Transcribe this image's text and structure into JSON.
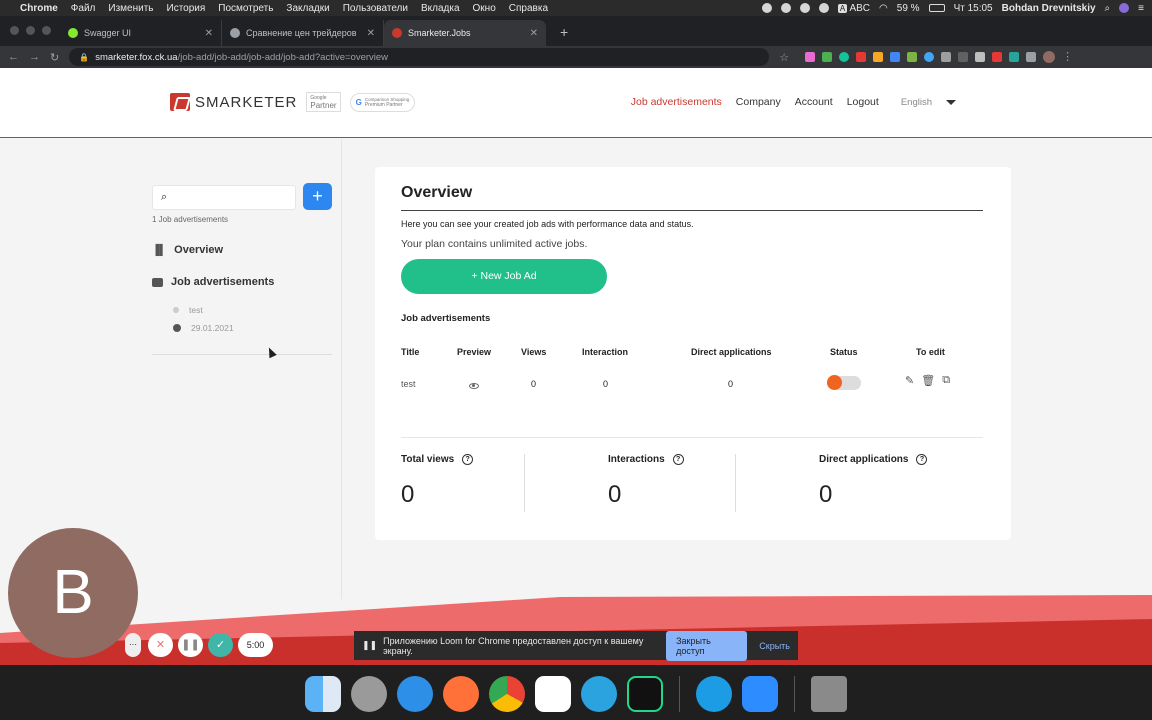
{
  "menubar": {
    "app": "Chrome",
    "items": [
      "Файл",
      "Изменить",
      "История",
      "Посмотреть",
      "Закладки",
      "Пользователи",
      "Вкладка",
      "Окно",
      "Справка"
    ],
    "battery": "59 %",
    "clock": "Чт 15:05",
    "user": "Bohdan Drevnitskiy",
    "input_lang": "ABC"
  },
  "tabs": [
    {
      "title": "Swagger UI",
      "color": "#85ea2d"
    },
    {
      "title": "Сравнение цен трейдеров",
      "color": "#9aa0a6"
    },
    {
      "title": "Smarketer.Jobs",
      "color": "#c9392f"
    }
  ],
  "address": {
    "domain": "smarketer.fox.ck.ua",
    "path": "/job-add/job-add/job-add/job-add?active=overview"
  },
  "header": {
    "logo": "SMARKETER",
    "badge1_top": "Google",
    "badge1_bottom": "Partner",
    "badge2_top": "Comparison Shopping",
    "badge2_bottom": "Premium Partner",
    "nav": [
      "Job advertisements",
      "Company",
      "Account",
      "Logout"
    ],
    "language": "English"
  },
  "sidebar": {
    "search_placeholder": "",
    "count": "1 Job advertisements",
    "overview": "Overview",
    "jobs": "Job advertisements",
    "job_title": "test",
    "job_date": "29.01.2021"
  },
  "card": {
    "title": "Overview",
    "description": "Here you can see your created job ads with performance data and status.",
    "plan": "Your plan contains unlimited active jobs.",
    "new_job": "+ New Job Ad",
    "section": "Job advertisements",
    "columns": [
      "Title",
      "Preview",
      "Views",
      "Interaction",
      "Direct applications",
      "Status",
      "To edit"
    ],
    "row": {
      "title": "test",
      "views": "0",
      "interaction": "0",
      "direct": "0"
    },
    "stats": [
      {
        "label": "Total views",
        "value": "0"
      },
      {
        "label": "Interactions",
        "value": "0"
      },
      {
        "label": "Direct applications",
        "value": "0"
      }
    ]
  },
  "loom": {
    "avatar": "B",
    "more": "···",
    "timer": "5:00",
    "notice": "Приложению Loom for Chrome предоставлен доступ к вашему экрану.",
    "stop": "Закрыть доступ",
    "hide": "Скрыть"
  }
}
